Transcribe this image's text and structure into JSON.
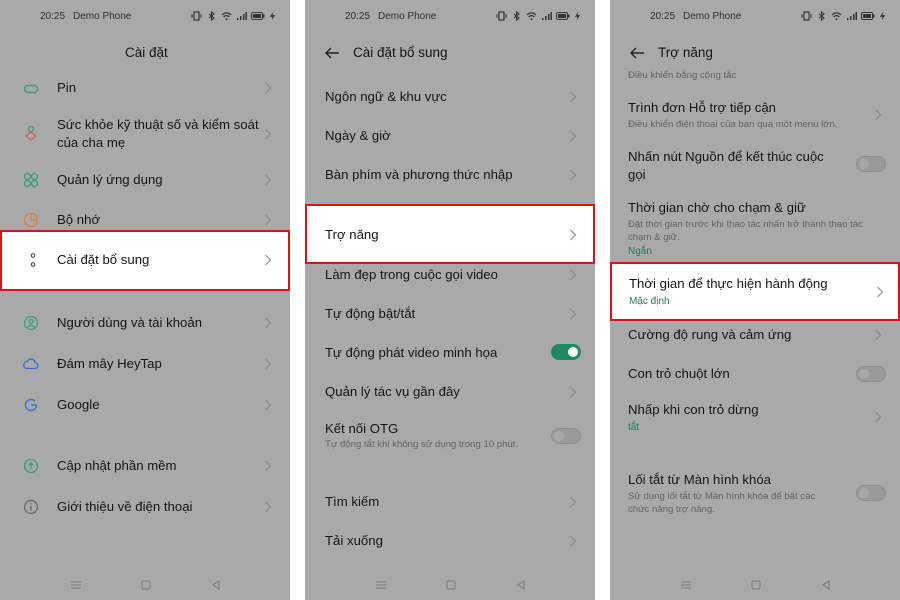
{
  "status_bar": {
    "time": "20:25",
    "carrier": "Demo Phone"
  },
  "panel1": {
    "title": "Cài đặt",
    "items": [
      {
        "label": "Pin",
        "icon": "battery-icon"
      },
      {
        "label": "Sức khỏe kỹ thuật số và kiểm soát của cha mẹ",
        "icon": "digital-wellbeing-icon"
      },
      {
        "label": "Quản lý ứng dụng",
        "icon": "apps-icon"
      },
      {
        "label": "Bộ nhớ",
        "icon": "storage-icon"
      },
      {
        "label": "Cài đặt bổ sung",
        "icon": "more-settings-icon",
        "highlighted": true
      },
      {
        "label": "Người dùng và tài khoản",
        "icon": "user-icon"
      },
      {
        "label": "Đám mây HeyTap",
        "icon": "cloud-icon"
      },
      {
        "label": "Google",
        "icon": "google-icon"
      },
      {
        "label": "Cập nhật phần mềm",
        "icon": "update-icon"
      },
      {
        "label": "Giới thiệu về điện thoại",
        "icon": "info-icon"
      }
    ]
  },
  "panel2": {
    "title": "Cài đặt bổ sung",
    "items": [
      {
        "label": "Ngôn ngữ & khu vực"
      },
      {
        "label": "Ngày & giờ"
      },
      {
        "label": "Bàn phím và phương thức nhập"
      },
      {
        "label": "Trợ năng",
        "highlighted": true
      },
      {
        "label": "Làm đẹp trong cuộc gọi video"
      },
      {
        "label": "Tự động bật/tắt"
      },
      {
        "label": "Tự động phát video minh họa",
        "toggle": true
      },
      {
        "label": "Quản lý tác vụ gần đây"
      },
      {
        "label": "Kết nối OTG",
        "sub": "Tự động tắt khi không sử dụng trong 10 phút.",
        "toggle": false
      },
      {
        "label": "Tìm kiếm"
      },
      {
        "label": "Tải xuống"
      }
    ]
  },
  "panel3": {
    "title": "Trợ năng",
    "top_sub": "Điều khiển bằng công tắc",
    "items": [
      {
        "label": "Trình đơn Hỗ trợ tiếp cận",
        "sub": "Điều khiển điện thoại của bạn qua một menu lớn."
      },
      {
        "label": "Nhấn nút Nguồn để kết thúc cuộc gọi",
        "toggle": false
      },
      {
        "label": "Thời gian chờ cho chạm & giữ",
        "sub": "Đặt thời gian trước khi thao tác nhấn trở thành thao tác chạm & giữ.",
        "value": "Ngắn"
      },
      {
        "label": "Thời gian để thực hiện hành động",
        "value": "Mặc định",
        "highlighted": true
      },
      {
        "label": "Cường độ rung và cảm ứng"
      },
      {
        "label": "Con trỏ chuột lớn",
        "toggle": false
      },
      {
        "label": "Nhấp khi con trỏ dừng",
        "value": "tắt"
      },
      {
        "label": "Lối tắt từ Màn hình khóa",
        "sub": "Sử dụng lối tắt từ Màn hình khóa để bật các chức năng trợ năng.",
        "toggle": false
      }
    ]
  },
  "colors": {
    "panel_bg": "#a9a9a9",
    "highlight_border": "#d9131a",
    "accent_green": "#1e8a60"
  }
}
